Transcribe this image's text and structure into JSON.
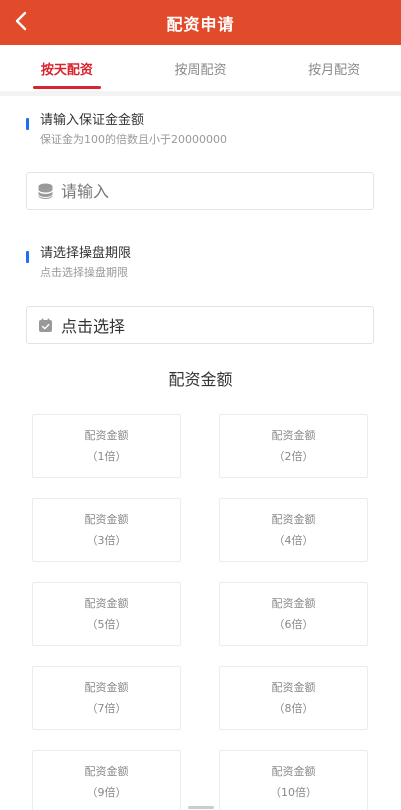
{
  "header": {
    "title": "配资申请"
  },
  "tabs": [
    {
      "label": "按天配资",
      "active": true
    },
    {
      "label": "按周配资",
      "active": false
    },
    {
      "label": "按月配资",
      "active": false
    }
  ],
  "margin_section": {
    "title": "请输入保证金金额",
    "subtitle": "保证金为100的倍数且小于20000000",
    "placeholder": "请输入"
  },
  "period_section": {
    "title": "请选择操盘期限",
    "subtitle": "点击选择操盘期限",
    "select_text": "点击选择"
  },
  "amount_grid": {
    "title": "配资金额",
    "cards": [
      {
        "label": "配资金额",
        "multiple": "（1倍）"
      },
      {
        "label": "配资金额",
        "multiple": "（2倍）"
      },
      {
        "label": "配资金额",
        "multiple": "（3倍）"
      },
      {
        "label": "配资金额",
        "multiple": "（4倍）"
      },
      {
        "label": "配资金额",
        "multiple": "（5倍）"
      },
      {
        "label": "配资金额",
        "multiple": "（6倍）"
      },
      {
        "label": "配资金额",
        "multiple": "（7倍）"
      },
      {
        "label": "配资金额",
        "multiple": "（8倍）"
      },
      {
        "label": "配资金额",
        "multiple": "（9倍）"
      },
      {
        "label": "配资金额",
        "multiple": "（10倍）"
      }
    ]
  },
  "colors": {
    "header": "#e14a2a",
    "active_tab": "#d9232d",
    "section_marker": "#1f6ff2"
  },
  "icons": {
    "back": "chevron-left-icon",
    "margin": "coin-stack-icon",
    "period": "calendar-icon"
  }
}
